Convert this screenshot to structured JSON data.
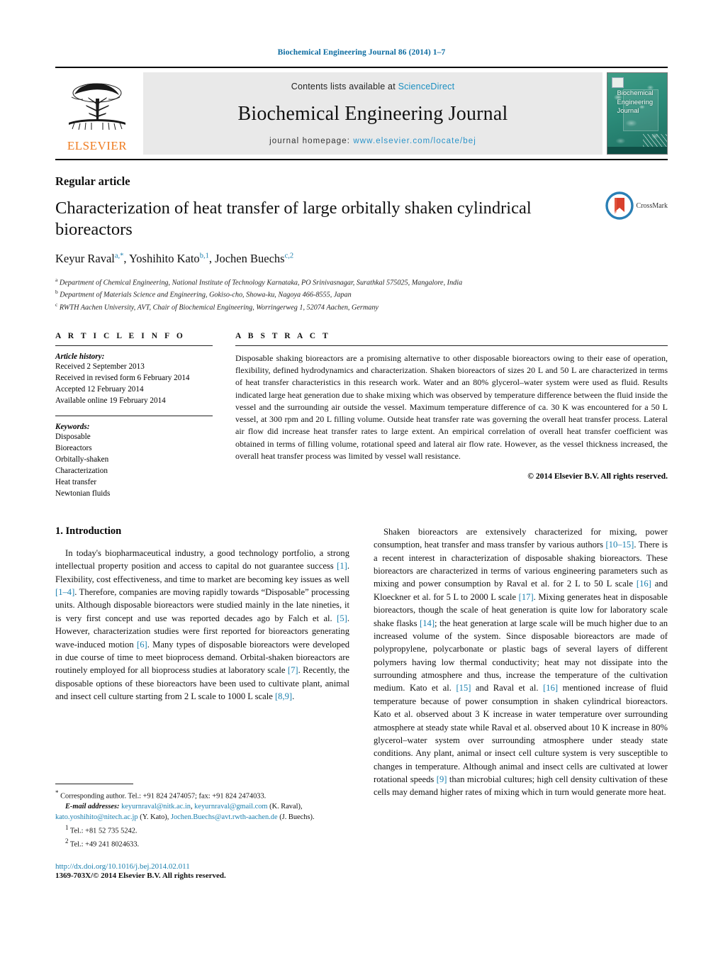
{
  "running_head": "Biochemical Engineering Journal 86 (2014) 1–7",
  "masthead": {
    "contents_prefix": "Contents lists available at",
    "sciencedirect": "ScienceDirect",
    "journal_name": "Biochemical Engineering Journal",
    "homepage_prefix": "journal homepage:",
    "homepage_url": "www.elsevier.com/locate/bej",
    "publisher": "ELSEVIER",
    "cover_title_line1": "Biochemical",
    "cover_title_line2": "Engineering",
    "cover_title_line3": "Journal"
  },
  "article": {
    "type": "Regular article",
    "title": "Characterization of heat transfer of large orbitally shaken cylindrical bioreactors",
    "crossmark_label": "CrossMark",
    "authors": [
      {
        "name": "Keyur Raval",
        "sup": "a,*"
      },
      {
        "name": "Yoshihito Kato",
        "sup": "b,1"
      },
      {
        "name": "Jochen Buechs",
        "sup": "c,2"
      }
    ],
    "affiliations": [
      {
        "marker": "a",
        "text": "Department of Chemical Engineering, National Institute of Technology Karnataka, PO Srinivasnagar, Surathkal 575025, Mangalore, India"
      },
      {
        "marker": "b",
        "text": "Department of Materials Science and Engineering, Gokiso-cho, Showa-ku, Nagoya 466-8555, Japan"
      },
      {
        "marker": "c",
        "text": "RWTH Aachen University, AVT, Chair of Biochemical Engineering, Worringerweg 1, 52074 Aachen, Germany"
      }
    ]
  },
  "article_info": {
    "heading": "A R T I C L E   I N F O",
    "history_label": "Article history:",
    "history": [
      "Received 2 September 2013",
      "Received in revised form 6 February 2014",
      "Accepted 12 February 2014",
      "Available online 19 February 2014"
    ],
    "keywords_label": "Keywords:",
    "keywords": [
      "Disposable",
      "Bioreactors",
      "Orbitally-shaken",
      "Characterization",
      "Heat transfer",
      "Newtonian fluids"
    ]
  },
  "abstract": {
    "heading": "A B S T R A C T",
    "text": "Disposable shaking bioreactors are a promising alternative to other disposable bioreactors owing to their ease of operation, flexibility, defined hydrodynamics and characterization. Shaken bioreactors of sizes 20 L and 50 L are characterized in terms of heat transfer characteristics in this research work. Water and an 80% glycerol–water system were used as fluid. Results indicated large heat generation due to shake mixing which was observed by temperature difference between the fluid inside the vessel and the surrounding air outside the vessel. Maximum temperature difference of ca. 30 K was encountered for a 50 L vessel, at 300 rpm and 20 L filling volume. Outside heat transfer rate was governing the overall heat transfer process. Lateral air flow did increase heat transfer rates to large extent. An empirical correlation of overall heat transfer coefficient was obtained in terms of filling volume, rotational speed and lateral air flow rate. However, as the vessel thickness increased, the overall heat transfer process was limited by vessel wall resistance.",
    "copyright": "© 2014 Elsevier B.V. All rights reserved."
  },
  "introduction": {
    "heading": "1.  Introduction",
    "left_paragraph_part1": "In today's biopharmaceutical industry, a good technology portfolio, a strong intellectual property position and access to capital do not guarantee success ",
    "cite_1": "[1]",
    "left_paragraph_part2": ". Flexibility, cost effectiveness, and time to market are becoming key issues as well ",
    "cite_1_4": "[1–4]",
    "left_paragraph_part3": ". Therefore, companies are moving rapidly towards “Disposable” processing units. Although disposable bioreactors were studied mainly in the late nineties, it is very first concept and use was reported decades ago by Falch et al. ",
    "cite_5": "[5]",
    "left_paragraph_part4": ". However, characterization studies were first reported for bioreactors generating wave-induced motion ",
    "cite_6": "[6]",
    "left_paragraph_part5": ". Many types of disposable bioreactors were developed in due course of time to meet bioprocess demand. Orbital-shaken bioreactors are routinely employed for all bioprocess studies at laboratory scale ",
    "cite_7": "[7]",
    "left_paragraph_part6": ". Recently, the disposable options of these bioreactors have been used to cultivate plant, animal and insect cell culture starting from 2 L scale to 1000 L scale ",
    "cite_8_9": "[8,9]",
    "left_paragraph_part7": ".",
    "right_paragraph_part1": "Shaken bioreactors are extensively characterized for mixing, power consumption, heat transfer and mass transfer by various authors ",
    "cite_10_15": "[10–15]",
    "right_paragraph_part2": ". There is a recent interest in characterization of disposable shaking bioreactors. These bioreactors are characterized in terms of various engineering parameters such as mixing and power consumption by Raval et al. for 2 L to 50 L scale ",
    "cite_16": "[16]",
    "right_paragraph_part3": " and Kloeckner et al. for 5 L to 2000 L scale ",
    "cite_17": "[17]",
    "right_paragraph_part4": ". Mixing generates heat in disposable bioreactors, though the scale of heat generation is quite low for laboratory scale shake flasks ",
    "cite_14": "[14]",
    "right_paragraph_part5": "; the heat generation at large scale will be much higher due to an increased volume of the system. Since disposable bioreactors are made of polypropylene, polycarbonate or plastic bags of several layers of different polymers having low thermal conductivity; heat may not dissipate into the surrounding atmosphere and thus, increase the temperature of the cultivation medium. Kato et al. ",
    "cite_15": "[15]",
    "right_paragraph_part6": " and Raval et al. ",
    "cite_16b": "[16]",
    "right_paragraph_part7": " mentioned increase of fluid temperature because of power consumption in shaken cylindrical bioreactors. Kato et al. observed about 3 K increase in water temperature over surrounding atmosphere at steady state while Raval et al. observed about 10 K increase in 80% glycerol–water system over surrounding atmosphere under steady state conditions. Any plant, animal or insect cell culture system is very susceptible to changes in temperature. Although animal and insect cells are cultivated at lower rotational speeds ",
    "cite_9": "[9]",
    "right_paragraph_part8": " than microbial cultures; high cell density cultivation of these cells may demand higher rates of mixing which in turn would generate more heat."
  },
  "footnotes": {
    "corresponding_marker": "*",
    "corresponding_text": "Corresponding author. Tel.: +91 824 2474057; fax: +91 824 2474033.",
    "email_label": "E-mail addresses:",
    "email_1": "keyurnraval@nitk.ac.in",
    "email_2": "keyurnraval@gmail.com",
    "email_1_owner": "(K. Raval),",
    "email_3": "kato.yoshihito@nitech.ac.jp",
    "email_3_owner": "(Y. Kato),",
    "email_4": "Jochen.Buechs@avt.rwth-aachen.de",
    "email_4_owner": "(J. Buechs).",
    "note_1_marker": "1",
    "note_1": "Tel.: +81 52 735 5242.",
    "note_2_marker": "2",
    "note_2": "Tel.: +49 241 8024633.",
    "doi": "http://dx.doi.org/10.1016/j.bej.2014.02.011",
    "issn": "1369-703X/© 2014 Elsevier B.V. All rights reserved."
  },
  "colors": {
    "link_blue": "#1a7fae",
    "header_blue": "#0b6ba0",
    "elsevier_orange": "#ef7c21",
    "cover_teal": "#2e8f7d"
  }
}
